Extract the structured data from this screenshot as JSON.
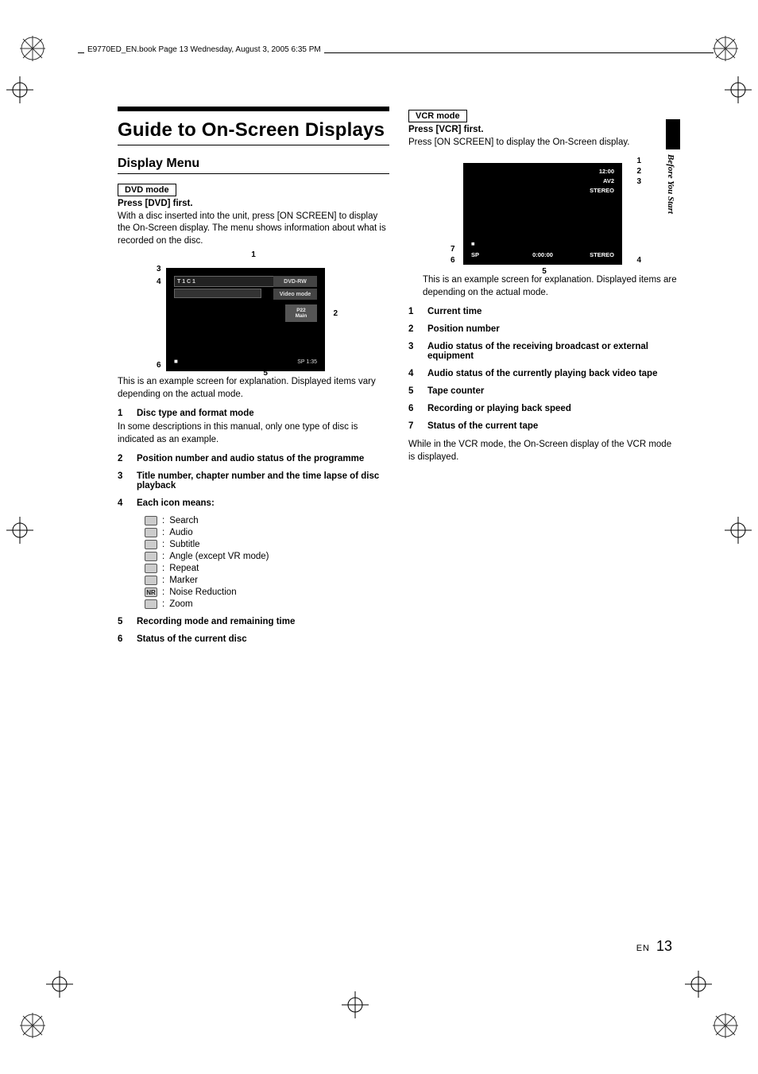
{
  "header_strip": "E9770ED_EN.book  Page 13  Wednesday, August 3, 2005  6:35 PM",
  "title": "Guide to On-Screen Displays",
  "subsection": "Display Menu",
  "dvd": {
    "mode_label": "DVD mode",
    "line1": "Press [DVD] first.",
    "para": "With a disc inserted into the unit, press [ON SCREEN] to display the On-Screen display. The menu shows information about what is recorded on the disc.",
    "diagram": {
      "topbar_left": "T  1   C  1",
      "right1": "DVD-RW",
      "right2": "Video mode",
      "right3a": "P22",
      "right3b": "Main",
      "bot_left_symbol": "■",
      "bot_right": "SP        1:35",
      "callouts": {
        "c1": "1",
        "c2": "2",
        "c3": "3",
        "c4": "4",
        "c5": "5",
        "c6": "6"
      }
    },
    "caption": "This is an example screen for explanation. Displayed items vary depending on the actual mode.",
    "items": [
      {
        "n": "1",
        "t": "Disc type and format mode",
        "extra": "In some descriptions in this manual, only one type of disc is indicated as an example."
      },
      {
        "n": "2",
        "t": "Position number and audio status of the programme"
      },
      {
        "n": "3",
        "t": "Title number, chapter number and the time lapse of disc playback"
      },
      {
        "n": "4",
        "t": "Each icon means:"
      },
      {
        "n": "5",
        "t": "Recording mode and remaining time"
      },
      {
        "n": "6",
        "t": "Status of the current disc"
      }
    ],
    "icons": [
      {
        "label": "Search"
      },
      {
        "label": "Audio"
      },
      {
        "label": "Subtitle"
      },
      {
        "label": "Angle (except VR mode)"
      },
      {
        "label": "Repeat"
      },
      {
        "label": "Marker"
      },
      {
        "label": "Noise Reduction"
      },
      {
        "label": "Zoom"
      }
    ]
  },
  "vcr": {
    "mode_label": "VCR mode",
    "line1": "Press [VCR] first.",
    "para": "Press [ON SCREEN] to display the On-Screen display.",
    "diagram": {
      "tr1": "12:00",
      "tr2": "AV2",
      "tr3": "STEREO",
      "bl_sym": "■",
      "bl_sp": "SP",
      "bc": "0:00:00",
      "br": "STEREO",
      "callouts": {
        "c1": "1",
        "c2": "2",
        "c3": "3",
        "c4": "4",
        "c5": "5",
        "c6": "6",
        "c7": "7"
      }
    },
    "caption": "This is an example screen for explanation. Displayed items are depending on the actual mode.",
    "items": [
      {
        "n": "1",
        "t": "Current time"
      },
      {
        "n": "2",
        "t": "Position number"
      },
      {
        "n": "3",
        "t": "Audio status of the receiving broadcast or external equipment"
      },
      {
        "n": "4",
        "t": "Audio status of the currently playing back video tape"
      },
      {
        "n": "5",
        "t": "Tape counter"
      },
      {
        "n": "6",
        "t": "Recording or playing back speed"
      },
      {
        "n": "7",
        "t": "Status of the current tape"
      }
    ],
    "outro": "While in the VCR mode, the On-Screen display of the VCR mode is displayed."
  },
  "side_tab": "Before You Start",
  "footer_en": "EN",
  "footer_page": "13"
}
